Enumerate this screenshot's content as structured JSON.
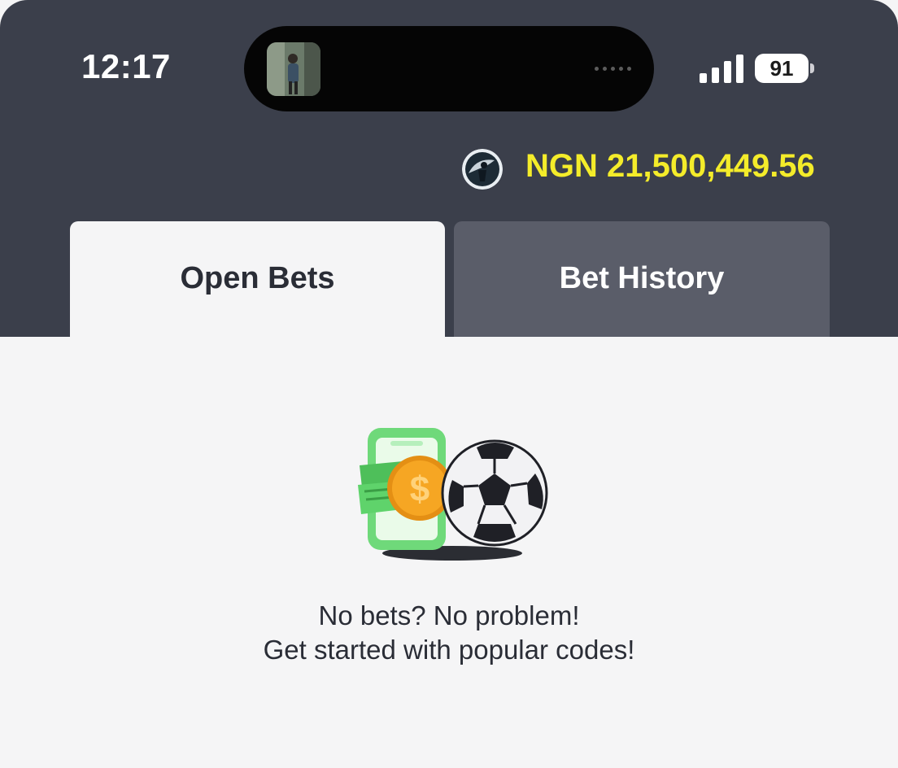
{
  "status_bar": {
    "time": "12:17",
    "battery": "91"
  },
  "account": {
    "balance": "NGN 21,500,449.56"
  },
  "tabs": [
    {
      "label": "Open Bets",
      "active": true
    },
    {
      "label": "Bet History",
      "active": false
    }
  ],
  "empty_state": {
    "line1": "No bets? No problem!",
    "line2": "Get started with popular codes!",
    "illustration_icons": [
      "phone-money-icon",
      "coin-icon",
      "soccer-ball-icon"
    ]
  },
  "colors": {
    "header_bg": "#3b3f4b",
    "balance": "#f4ec2a",
    "active_tab_bg": "#f5f5f6",
    "inactive_tab_bg": "#5a5d69",
    "money_green": "#5fd36b",
    "coin_orange": "#f6a623"
  }
}
